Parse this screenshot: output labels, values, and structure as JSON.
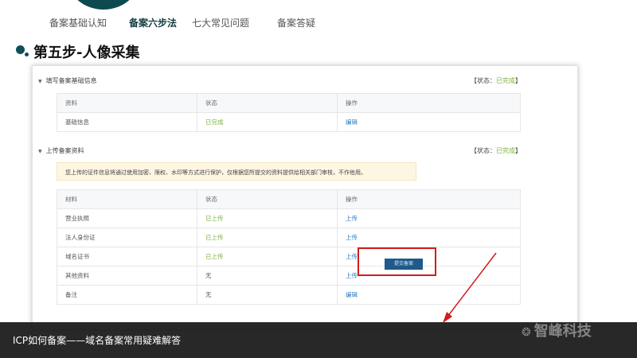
{
  "nav": {
    "tabs": [
      {
        "label": "备案基础认知"
      },
      {
        "label": "备案六步法"
      },
      {
        "label": "七大常见问题"
      },
      {
        "label": "备案答疑"
      }
    ],
    "active_index": 1
  },
  "step_title": "第五步-人像采集",
  "section1": {
    "title": "填写备案基础信息",
    "status_prefix": "【状态：",
    "status_value": "已完成",
    "status_suffix": "】",
    "table": {
      "headers": [
        "资料",
        "状态",
        "操作"
      ],
      "rows": [
        {
          "name": "基础信息",
          "status": "已完成",
          "action": "编辑"
        }
      ]
    }
  },
  "section2": {
    "title": "上传备案资料",
    "status_prefix": "【状态：",
    "status_value": "已完成",
    "status_suffix": "】",
    "notice": "您上传的证件信息将通过使用加密、限权、水印等方式进行保护，仅根据您所提交的资料提供给相关部门审核，不作他用。",
    "table": {
      "headers": [
        "材料",
        "状态",
        "操作"
      ],
      "rows": [
        {
          "name": "营业执照",
          "status": "已上传",
          "action": "上传"
        },
        {
          "name": "法人身份证",
          "status": "已上传",
          "action": "上传"
        },
        {
          "name": "域名证书",
          "status": "已上传",
          "action": "上传"
        },
        {
          "name": "其他资料",
          "status": "无",
          "action": "上传"
        },
        {
          "name": "备注",
          "status": "无",
          "action": "编辑"
        }
      ]
    }
  },
  "submit_label": "提交备案",
  "caption": "ICP如何备案——域名备案常用疑难解答",
  "watermark": "智峰科技",
  "colors": {
    "accent": "#0d5156",
    "done": "#7cb342",
    "link": "#2b7ac2",
    "highlight": "#d41c1c"
  }
}
